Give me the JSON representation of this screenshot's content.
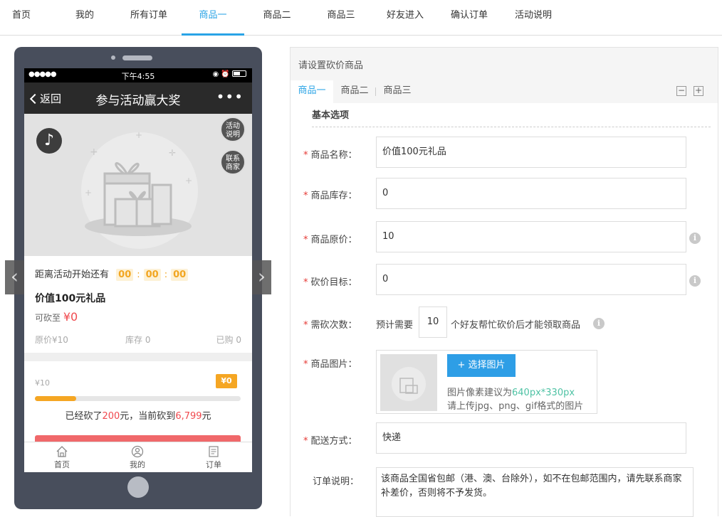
{
  "topnav": {
    "tabs": [
      {
        "label": "首页"
      },
      {
        "label": "我的"
      },
      {
        "label": "所有订单"
      },
      {
        "label": "商品一"
      },
      {
        "label": "商品二"
      },
      {
        "label": "商品三"
      },
      {
        "label": "好友进入"
      },
      {
        "label": "确认订单"
      },
      {
        "label": "活动说明"
      }
    ],
    "active_index": 3,
    "accent_color": "#29a3e6"
  },
  "phone": {
    "status": {
      "signal": "●●●●●",
      "time": "下午4:55",
      "icons": "◉ ⏰"
    },
    "titlebar": {
      "back_label": "返回",
      "title": "参与活动赢大奖",
      "more": "•••"
    },
    "banner": {
      "music_icon": "music-note-icon",
      "btn_rules": "活动\n说明",
      "btn_contact": "联系\n商家"
    },
    "info": {
      "countdown_label": "距离活动开始还有",
      "countdown": [
        "00",
        "00",
        "00"
      ],
      "product_name": "价值100元礼品",
      "can_cut_label": "可砍至",
      "can_cut_price": "¥0",
      "original_price": "原价¥10",
      "stock": "库存 0",
      "sold": "已购 0"
    },
    "progress": {
      "start_price": "¥10",
      "target_badge": "¥0",
      "fill_fraction": 0.2,
      "cut_prefix": "已经砍了",
      "cut_amount": "200",
      "cut_mid": "元，当前砍到",
      "current_amount": "6,799",
      "cut_suffix": "元"
    },
    "bottomnav": [
      {
        "label": "首页",
        "icon": "home-icon"
      },
      {
        "label": "我的",
        "icon": "user-icon"
      },
      {
        "label": "订单",
        "icon": "order-icon"
      }
    ]
  },
  "form": {
    "header": "请设置砍价商品",
    "tabs": [
      {
        "label": "商品一"
      },
      {
        "label": "商品二"
      },
      {
        "label": "商品三"
      }
    ],
    "collapse": "−",
    "expand": "+",
    "section_title": "基本选项",
    "name": {
      "label": "商品名称：",
      "value": "价值100元礼品"
    },
    "stock": {
      "label": "商品库存：",
      "value": "0"
    },
    "price": {
      "label": "商品原价：",
      "value": "10"
    },
    "target": {
      "label": "砍价目标：",
      "value": "0"
    },
    "times": {
      "label": "需砍次数：",
      "prefix": "预计需要",
      "value": "10",
      "suffix": "个好友帮忙砍价后才能领取商品"
    },
    "image": {
      "label": "商品图片：",
      "button": "+ 选择图片",
      "hint1_prefix": "图片像素建议为",
      "hint1_size": "640px*330px",
      "hint2": "请上传jpg、png、gif格式的图片"
    },
    "delivery": {
      "label": "配送方式：",
      "value": "快递"
    },
    "order_note": {
      "label": "订单说明：",
      "value": "该商品全国省包邮（港、澳、台除外），如不在包邮范围内，请先联系商家补差价，否则将不予发货。"
    },
    "required_mark": "*",
    "info_icon": "i"
  }
}
